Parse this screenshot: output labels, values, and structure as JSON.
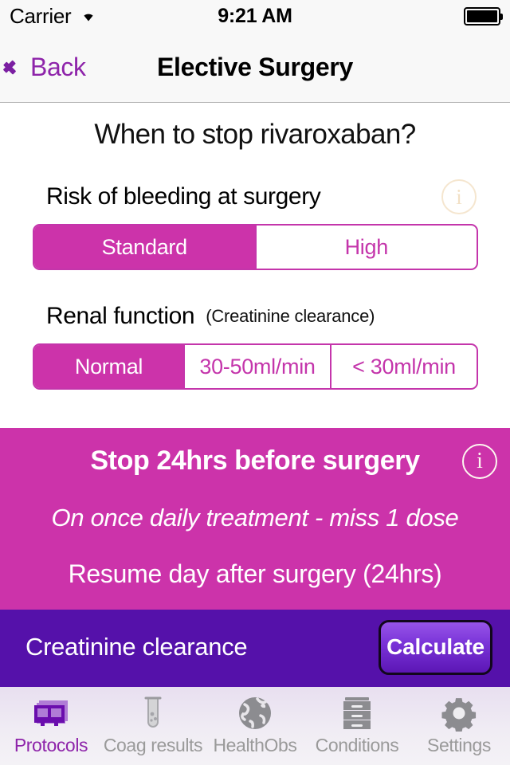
{
  "status_bar": {
    "carrier": "Carrier",
    "wifi_icon": "wifi-icon",
    "time": "9:21 AM",
    "battery_icon": "battery-full-icon"
  },
  "nav": {
    "back_label": "Back",
    "back_icon": "chevron-left-icon",
    "title": "Elective Surgery"
  },
  "main": {
    "question": "When to stop rivaroxaban?",
    "bleeding": {
      "label": "Risk of bleeding at surgery",
      "info_icon": "info-icon",
      "options": [
        {
          "label": "Standard",
          "selected": true
        },
        {
          "label": "High",
          "selected": false
        }
      ]
    },
    "renal": {
      "label": "Renal function",
      "sublabel": "(Creatinine clearance)",
      "options": [
        {
          "label": "Normal",
          "selected": true
        },
        {
          "label": "30-50ml/min",
          "selected": false
        },
        {
          "label": "< 30ml/min",
          "selected": false
        }
      ]
    }
  },
  "result": {
    "headline": "Stop 24hrs before surgery",
    "info_icon": "info-icon",
    "note": "On once daily treatment - miss 1 dose",
    "resume": "Resume day after surgery (24hrs)"
  },
  "calculator": {
    "label": "Creatinine clearance",
    "button_label": "Calculate"
  },
  "tabs": [
    {
      "label": "Protocols",
      "icon": "documents-stack-icon",
      "active": true
    },
    {
      "label": "Coag results",
      "icon": "test-tube-icon",
      "active": false
    },
    {
      "label": "HealthObs",
      "icon": "globe-icon",
      "active": false
    },
    {
      "label": "Conditions",
      "icon": "file-cabinet-icon",
      "active": false
    },
    {
      "label": "Settings",
      "icon": "gear-icon",
      "active": false
    }
  ],
  "colors": {
    "magenta": "#cc33aa",
    "purple": "#5511aa",
    "accent_link": "#8e24aa"
  }
}
